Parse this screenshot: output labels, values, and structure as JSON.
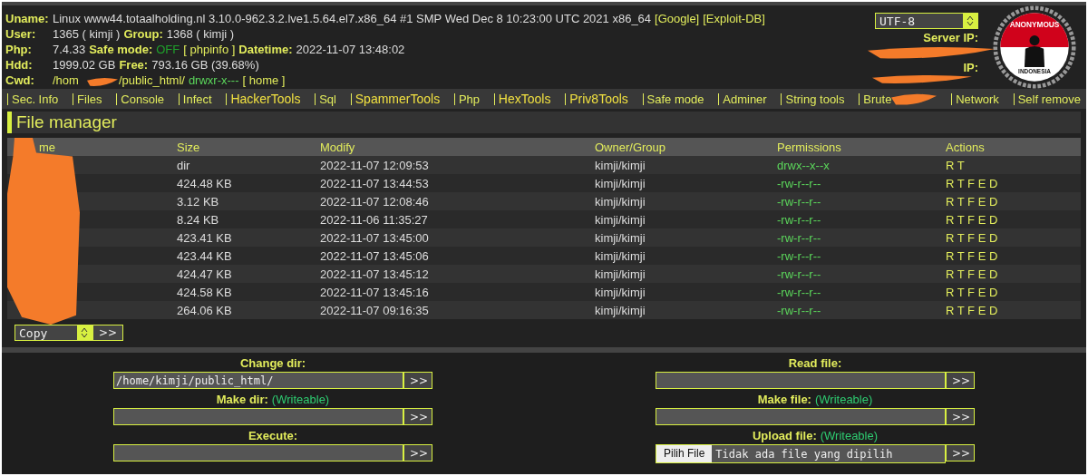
{
  "info": [
    {
      "label": "Uname:",
      "parts": [
        {
          "kind": "text",
          "text": "Linux www44.totaalholding.nl 3.10.0-962.3.2.lve1.5.64.el7.x86_64 #1 SMP Wed Dec 8 10:23:00 UTC 2021 x86_64"
        },
        {
          "kind": "link",
          "text": "[Google]"
        },
        {
          "kind": "link",
          "text": "[Exploit-DB]"
        }
      ]
    },
    {
      "label": "User:",
      "parts": [
        {
          "kind": "text",
          "text": "1365 ( kimji )"
        },
        {
          "kind": "label",
          "text": "Group:"
        },
        {
          "kind": "text",
          "text": "1368 ( kimji )"
        }
      ]
    },
    {
      "label": "Php:",
      "parts": [
        {
          "kind": "text",
          "text": "7.4.33"
        },
        {
          "kind": "label",
          "text": "Safe mode:"
        },
        {
          "kind": "off",
          "text": "OFF"
        },
        {
          "kind": "link",
          "text": "[ phpinfo ]"
        },
        {
          "kind": "label",
          "text": "Datetime:"
        },
        {
          "kind": "text",
          "text": "2022-11-07 13:48:02"
        }
      ]
    },
    {
      "label": "Hdd:",
      "parts": [
        {
          "kind": "text",
          "text": "1999.02 GB"
        },
        {
          "kind": "label",
          "text": "Free:"
        },
        {
          "kind": "text",
          "text": "793.16 GB (39.68%)"
        }
      ]
    },
    {
      "label": "Cwd:",
      "parts": [
        {
          "kind": "link",
          "text": "/hom"
        },
        {
          "kind": "gap",
          "text": "/public_html/"
        },
        {
          "kind": "perm",
          "text": "drwxr-x---"
        },
        {
          "kind": "link",
          "text": "[ home ]"
        }
      ]
    }
  ],
  "charset": {
    "value": "UTF-8"
  },
  "server_labels": [
    "Server IP:",
    "IP:"
  ],
  "logo": {
    "top": "ANONYMOUS",
    "bottom": "INDONESIA"
  },
  "menu": [
    {
      "label": "Sec. Info",
      "kind": "plain"
    },
    {
      "label": "Files",
      "kind": "plain"
    },
    {
      "label": "Console",
      "kind": "plain"
    },
    {
      "label": "Infect",
      "kind": "plain"
    },
    {
      "label": "HackerTools",
      "kind": "big"
    },
    {
      "label": "Sql",
      "kind": "plain"
    },
    {
      "label": "SpammerTools",
      "kind": "big"
    },
    {
      "label": "Php",
      "kind": "plain"
    },
    {
      "label": "HexTools",
      "kind": "big"
    },
    {
      "label": "Priv8Tools",
      "kind": "big"
    },
    {
      "label": "Safe mode",
      "kind": "plain"
    },
    {
      "label": "Adminer",
      "kind": "plain"
    },
    {
      "label": "String tools",
      "kind": "plain"
    },
    {
      "label": "Brute",
      "kind": "cut"
    },
    {
      "label": "Network",
      "kind": "plain"
    },
    {
      "label": "Self remove",
      "kind": "plain"
    }
  ],
  "file_manager": {
    "title": "File manager",
    "columns": [
      "me",
      "Size",
      "Modify",
      "Owner/Group",
      "Permissions",
      "Actions"
    ],
    "rows": [
      {
        "size": "dir",
        "modify": "2022-11-07 12:09:53",
        "owner": "kimji/kimji",
        "perms": "drwx--x--x",
        "actions": "R T"
      },
      {
        "size": "424.48 KB",
        "modify": "2022-11-07 13:44:53",
        "owner": "kimji/kimji",
        "perms": "-rw-r--r--",
        "actions": "R T F E D"
      },
      {
        "size": "3.12 KB",
        "modify": "2022-11-07 12:08:46",
        "owner": "kimji/kimji",
        "perms": "-rw-r--r--",
        "actions": "R T F E D"
      },
      {
        "size": "8.24 KB",
        "modify": "2022-11-06 11:35:27",
        "owner": "kimji/kimji",
        "perms": "-rw-r--r--",
        "actions": "R T F E D"
      },
      {
        "size": "423.41 KB",
        "modify": "2022-11-07 13:45:00",
        "owner": "kimji/kimji",
        "perms": "-rw-r--r--",
        "actions": "R T F E D"
      },
      {
        "size": "423.44 KB",
        "modify": "2022-11-07 13:45:06",
        "owner": "kimji/kimji",
        "perms": "-rw-r--r--",
        "actions": "R T F E D"
      },
      {
        "size": "424.47 KB",
        "modify": "2022-11-07 13:45:12",
        "owner": "kimji/kimji",
        "perms": "-rw-r--r--",
        "actions": "R T F E D"
      },
      {
        "size": "424.58 KB",
        "modify": "2022-11-07 13:45:16",
        "owner": "kimji/kimji",
        "perms": "-rw-r--r--",
        "actions": "R T F E D"
      },
      {
        "size": "264.06 KB",
        "modify": "2022-11-07 09:16:35",
        "owner": "kimji/kimji",
        "perms": "-rw-r--r--",
        "actions": "R T F E D"
      }
    ],
    "action_select": "Copy",
    "submit": ">>"
  },
  "forms": [
    [
      {
        "label": "Change dir:",
        "value": "/home/kimji/public_html/",
        "kind": "text",
        "button": ">>"
      },
      {
        "label": "Make dir:",
        "note": "(Writeable)",
        "kind": "text",
        "button": ">>"
      },
      {
        "label": "Execute:",
        "kind": "text",
        "button": ">>"
      }
    ],
    [
      {
        "label": "Read file:",
        "kind": "text",
        "button": ">>"
      },
      {
        "label": "Make file:",
        "note": "(Writeable)",
        "kind": "text",
        "button": ">>"
      },
      {
        "label": "Upload file:",
        "note": "(Writeable)",
        "kind": "file",
        "file_button": "Pilih File",
        "file_status": "Tidak ada file yang dipilih",
        "button": ">>"
      }
    ]
  ]
}
